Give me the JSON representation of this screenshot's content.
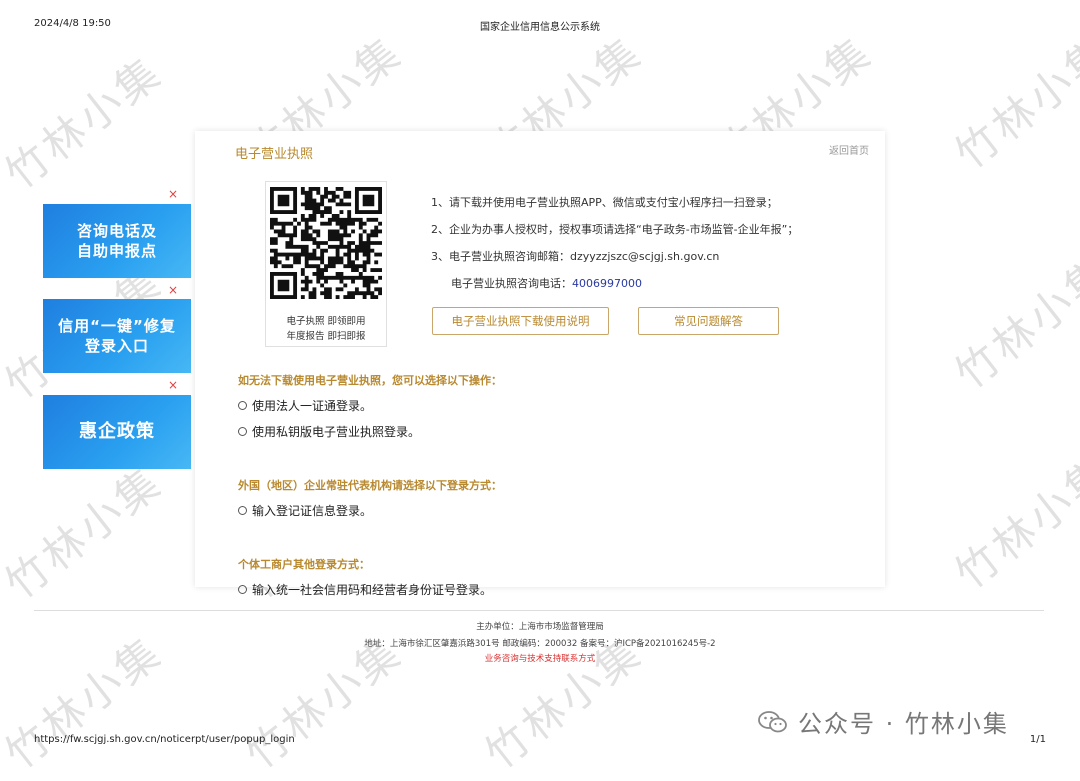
{
  "print": {
    "datetime": "2024/4/8 19:50",
    "title": "国家企业信用信息公示系统",
    "url": "https://fw.scjgj.sh.gov.cn/noticerpt/user/popup_login",
    "page": "1/1"
  },
  "watermark": "竹林小集",
  "card": {
    "title": "电子营业执照",
    "back_home": "返回首页",
    "qr_caption_line1": "电子执照 即领即用",
    "qr_caption_line2": "年度报告 即扫即报",
    "steps": {
      "s1": "1、请下载并使用电子营业执照APP、微信或支付宝小程序扫一扫登录；",
      "s2": "2、企业为办事人授权时，授权事项请选择“电子政务-市场监管-企业年报”；",
      "s3_label": "3、电子营业执照咨询邮箱：",
      "s3_email": "dzyyzzjszc@scjgj.sh.gov.cn",
      "phone_label": "电子营业执照咨询电话：",
      "phone": "4006997000"
    },
    "buttons": {
      "manual": "电子营业执照下载使用说明",
      "faq": "常见问题解答"
    },
    "sections": [
      {
        "title": "如无法下载使用电子营业执照，您可以选择以下操作：",
        "options": [
          "使用法人一证通登录。",
          "使用私钥版电子营业执照登录。"
        ]
      },
      {
        "title": "外国（地区）企业常驻代表机构请选择以下登录方式：",
        "options": [
          "输入登记证信息登录。"
        ]
      },
      {
        "title": "个体工商户其他登录方式：",
        "options": [
          "输入统一社会信用码和经营者身份证号登录。"
        ]
      }
    ]
  },
  "ads": [
    {
      "line1": "咨询电话及",
      "line2": "自助申报点",
      "close": "×"
    },
    {
      "line1": "信用“一键”修复",
      "line2": "登录入口",
      "close": "×"
    },
    {
      "line1": "惠企政策",
      "line2": "",
      "close": "×"
    }
  ],
  "footer": {
    "sponsor": "主办单位：上海市市场监督管理局",
    "address": "地址：上海市徐汇区肇嘉浜路301号  邮政编码：200032  备案号：沪ICP备2021016245号-2",
    "support": "业务咨询与技术支持联系方式"
  },
  "wechat_mark": "公众号 · 竹林小集",
  "colors": {
    "accent_gold": "#b8892f",
    "phone_blue": "#2a3aa0",
    "ad_blue": "#1f7fe0",
    "support_red": "#d83030"
  }
}
